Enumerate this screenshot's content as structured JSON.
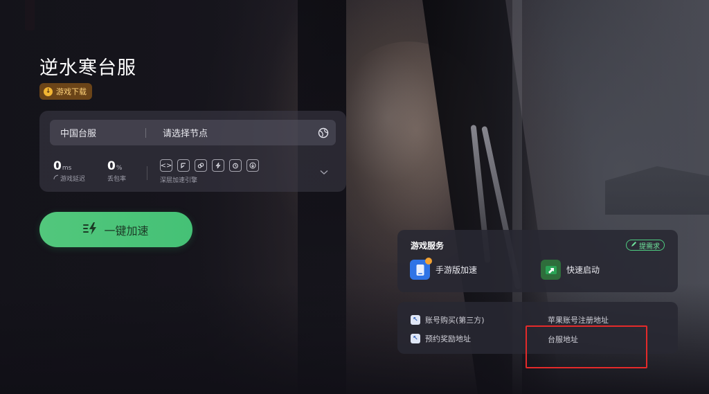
{
  "game": {
    "title": "逆水寒台服",
    "download_label": "游戏下载"
  },
  "network": {
    "region": "中国台服",
    "node_placeholder": "请选择节点",
    "latency_value": "0",
    "latency_unit": "ms",
    "latency_label": "游戏延迟",
    "loss_value": "0",
    "loss_unit": "%",
    "loss_label": "丢包率",
    "engine_label": "深层加速引擎",
    "engine_icons": [
      "code-icon",
      "route-icon",
      "link-icon",
      "bolt-icon",
      "timer-icon",
      "download-icon"
    ]
  },
  "boost": {
    "label": "一键加速"
  },
  "services": {
    "title": "游戏服务",
    "request_label": "提需求",
    "mobile_label": "手游版加速",
    "quick_label": "快速启动"
  },
  "links": {
    "account_buy": "账号购买(第三方)",
    "reward_addr": "预约奖励地址",
    "apple_register": "苹果账号注册地址",
    "tw_server_addr": "台服地址"
  },
  "colors": {
    "accent_green": "#4fc77c",
    "badge_orange": "#f2b533",
    "highlight_red": "#e52a2a"
  }
}
